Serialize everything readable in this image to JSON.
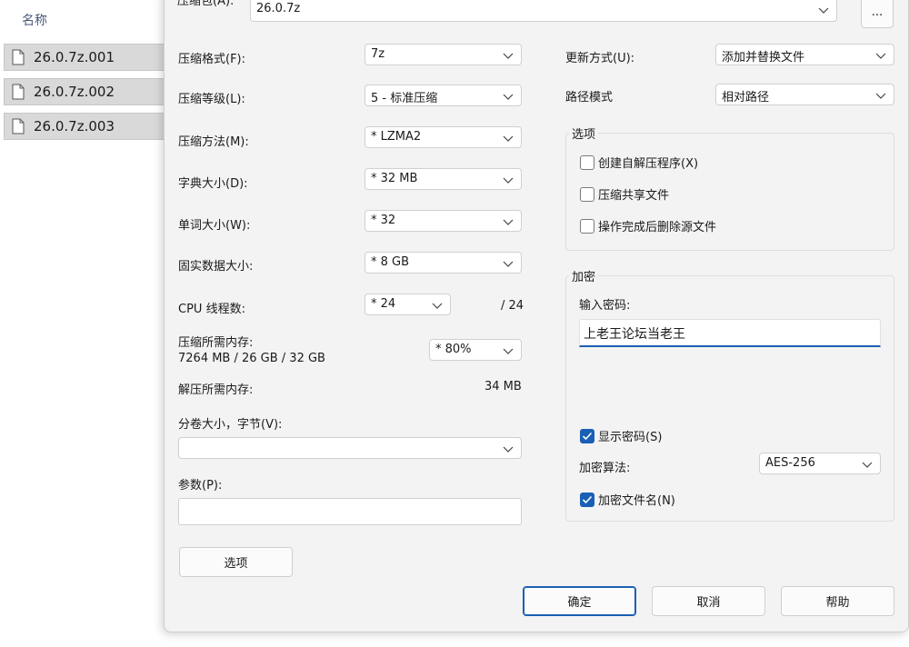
{
  "explorer": {
    "column_header": "名称",
    "files": [
      "26.0.7z.001",
      "26.0.7z.002",
      "26.0.7z.003"
    ]
  },
  "dialog": {
    "archive_label": "压缩包(A):",
    "archive_value": "26.0.7z",
    "browse_label": "...",
    "left": {
      "format_label": "压缩格式(F):",
      "format_value": "7z",
      "level_label": "压缩等级(L):",
      "level_value": "5 - 标准压缩",
      "method_label": "压缩方法(M):",
      "method_value": "* LZMA2",
      "dict_label": "字典大小(D):",
      "dict_value": "* 32 MB",
      "word_label": "单词大小(W):",
      "word_value": "* 32",
      "solid_label": "固实数据大小:",
      "solid_value": "* 8 GB",
      "threads_label": "CPU 线程数:",
      "threads_value": "* 24",
      "threads_total": "/ 24",
      "mem_comp_label": "压缩所需内存:",
      "mem_comp_value": "7264 MB / 26 GB / 32 GB",
      "mem_percent": "* 80%",
      "mem_decomp_label": "解压所需内存:",
      "mem_decomp_value": "34 MB",
      "volume_label": "分卷大小，字节(V):",
      "volume_value": "",
      "params_label": "参数(P):",
      "params_value": "",
      "options_button": "选项"
    },
    "right": {
      "update_label": "更新方式(U):",
      "update_value": "添加并替换文件",
      "path_label": "路径模式",
      "path_value": "相对路径",
      "options_group": "选项",
      "opt_sfx": "创建自解压程序(X)",
      "opt_shared": "压缩共享文件",
      "opt_delete": "操作完成后删除源文件",
      "encrypt_group": "加密",
      "password_label": "输入密码:",
      "password_value": "上老王论坛当老王",
      "show_password": "显示密码(S)",
      "enc_method_label": "加密算法:",
      "enc_method_value": "AES-256",
      "enc_names": "加密文件名(N)"
    },
    "buttons": {
      "ok": "确定",
      "cancel": "取消",
      "help": "帮助"
    },
    "checkbox_states": {
      "opt_sfx": false,
      "opt_shared": false,
      "opt_delete": false,
      "show_password": true,
      "enc_names": true
    },
    "accent_color": "#1a5fb4"
  }
}
